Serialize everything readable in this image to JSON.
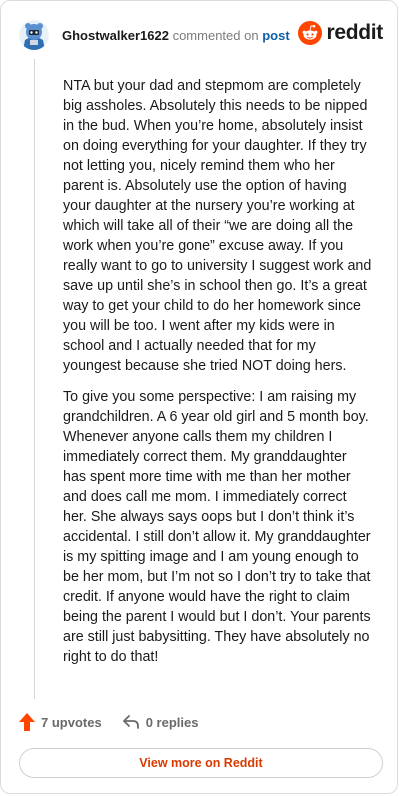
{
  "header": {
    "username": "Ghostwalker1622",
    "action_text": "commented on",
    "post_link": "post",
    "brand": "reddit"
  },
  "comment": {
    "paragraphs": [
      "NTA but your dad and stepmom are completely big assholes. Absolutely this needs to be nipped in the bud. When you’re home, absolutely insist on doing everything for your daughter. If they try not letting you, nicely remind them who her parent is. Absolutely use the option of having your daughter at the nursery you’re working at which will take all of their “we are doing all the work when you’re gone” excuse away. If you really want to go to university I suggest work and save up until she’s in school then go. It’s a great way to get your child to do her homework since you will be too. I went after my kids were in school and I actually needed that for my youngest because she tried NOT doing hers.",
      "To give you some perspective: I am raising my grandchildren. A 6 year old girl and 5 month boy. Whenever anyone calls them my children I immediately correct them. My granddaughter has spent more time with me than her mother and does call me mom. I immediately correct her. She always says oops but I don’t think it’s accidental. I still don’t allow it. My granddaughter is my spitting image and I am young enough to be her mom, but I’m not so I don’t try to take that credit. If anyone would have the right to claim being the parent I would but I don’t. Your parents are still just babysitting. They have absolutely no right to do that!"
    ]
  },
  "actions": {
    "upvotes": "7 upvotes",
    "replies": "0 replies"
  },
  "footer": {
    "view_more": "View more on Reddit"
  },
  "colors": {
    "brand_orange": "#ff4500",
    "link_blue": "#0f5fa8",
    "view_more_text": "#d93a00"
  },
  "icons": {
    "avatar": "snoo-avatar-blue-bear",
    "logo": "reddit-snoo-logo",
    "upvote": "upvote-arrow-icon",
    "reply": "reply-arrow-icon"
  }
}
